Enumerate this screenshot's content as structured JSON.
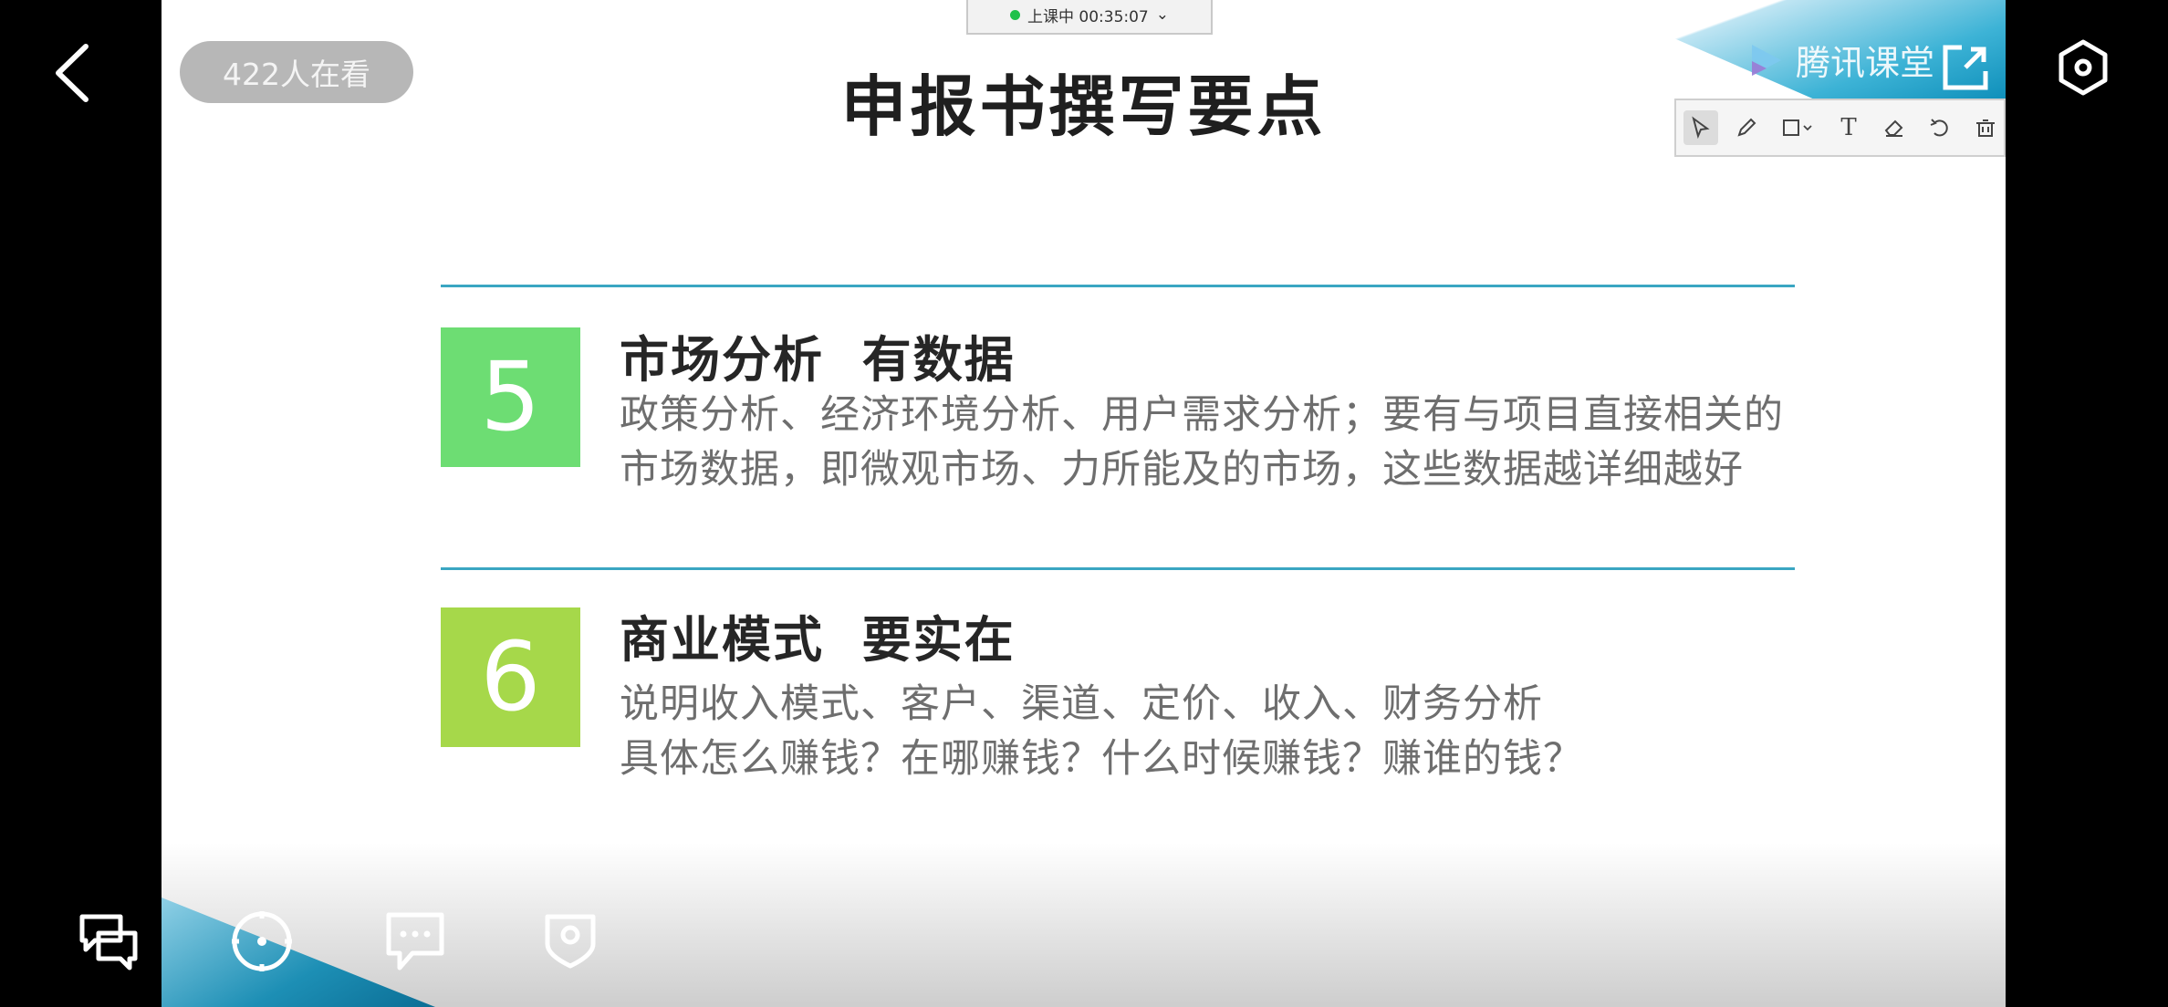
{
  "player": {
    "viewer_count": "422人在看"
  },
  "class_status": {
    "text": "上课中 00:35:07",
    "dropdown_glyph": "⌄"
  },
  "brand": {
    "name": "腾讯课堂"
  },
  "slide": {
    "title": "申报书撰写要点",
    "items": [
      {
        "number": "5",
        "color": "#6ddd73",
        "heading": "市场分析  有数据",
        "lines": [
          "政策分析、经济环境分析、用户需求分析；要有与项目直接相关的",
          "市场数据，即微观市场、力所能及的市场，这些数据越详细越好"
        ]
      },
      {
        "number": "6",
        "color": "#a6d84a",
        "heading": "商业模式  要实在",
        "lines": [
          "说明收入模式、客户、渠道、定价、收入、财务分析",
          "具体怎么赚钱？在哪赚钱？什么时候赚钱？赚谁的钱？"
        ]
      }
    ]
  },
  "toolbar": {
    "tools": [
      "select-icon",
      "pen-icon",
      "shape-icon",
      "text-icon",
      "eraser-icon",
      "undo-icon",
      "delete-icon"
    ],
    "text_tool_glyph": "T"
  },
  "icons": {
    "back": "back-chevron-icon",
    "fullscreen": "external-open-icon",
    "settings": "settings-icon",
    "bottom": [
      "chat-bubbles-icon",
      "compass-icon",
      "message-icon",
      "shield-icon"
    ]
  }
}
